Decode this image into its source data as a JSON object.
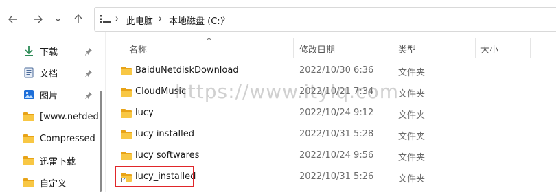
{
  "nav": {
    "back_icon": "arrow-left-icon",
    "forward_icon": "arrow-right-icon",
    "recent_icon": "chevron-down-icon",
    "up_icon": "arrow-up-icon"
  },
  "address_bar": {
    "crumbs": [
      "此电脑",
      "本地磁盘 (C:)"
    ],
    "separator": "›"
  },
  "sidebar": {
    "items": [
      {
        "label": "下载",
        "icon": "download-icon",
        "pinned": true
      },
      {
        "label": "文档",
        "icon": "document-icon",
        "pinned": true
      },
      {
        "label": "图片",
        "icon": "picture-icon",
        "pinned": true
      },
      {
        "label": "[www.netded.",
        "icon": "folder-icon",
        "pinned": false
      },
      {
        "label": "Compressed",
        "icon": "folder-icon",
        "pinned": false
      },
      {
        "label": "迅雷下载",
        "icon": "folder-icon",
        "pinned": false
      },
      {
        "label": "自定义",
        "icon": "folder-icon",
        "pinned": false
      }
    ]
  },
  "columns": {
    "name": "名称",
    "modified": "修改日期",
    "type": "类型",
    "size": "大小"
  },
  "files": [
    {
      "name": "BaiduNetdiskDownload",
      "modified": "2022/10/30 6:36",
      "type": "文件夹",
      "shortcut": false
    },
    {
      "name": "CloudMusic",
      "modified": "2022/10/21 7:34",
      "type": "文件夹",
      "shortcut": false
    },
    {
      "name": "lucy",
      "modified": "2022/10/24 9:12",
      "type": "文件夹",
      "shortcut": false
    },
    {
      "name": "lucy installed",
      "modified": "2022/10/31 5:28",
      "type": "文件夹",
      "shortcut": false
    },
    {
      "name": "lucy softwares",
      "modified": "2022/10/24 9:56",
      "type": "文件夹",
      "shortcut": false
    },
    {
      "name": "lucy_installed",
      "modified": "2022/10/31 5:26",
      "type": "文件夹",
      "shortcut": true
    }
  ],
  "watermark": "https://www.itylq.com",
  "colors": {
    "folder": "#f8c744",
    "highlight": "#e0262a",
    "download_arrow": "#2e8b57",
    "picture_icon": "#1e6fd9"
  }
}
